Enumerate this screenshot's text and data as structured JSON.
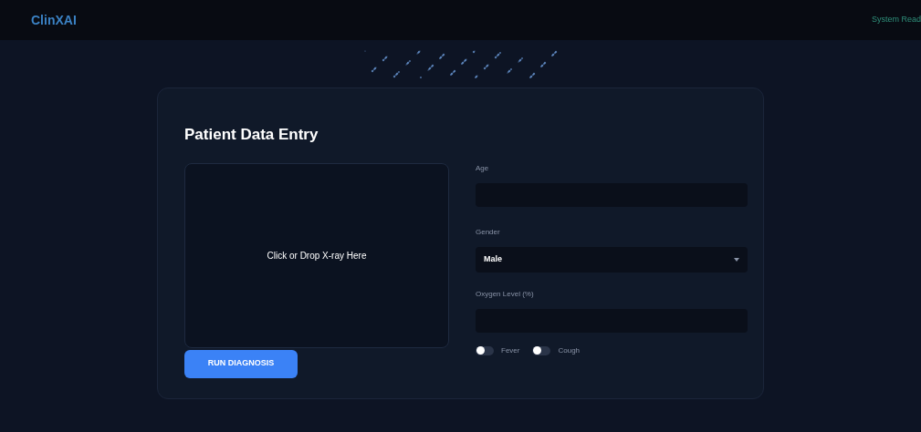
{
  "header": {
    "logo": "ClinXAI",
    "status": "System Read"
  },
  "form": {
    "title": "Patient Data Entry",
    "dropzone": "Click or Drop X-ray Here",
    "button": "RUN DIAGNOSIS",
    "fields": [
      {
        "kind": "input",
        "label": "Age"
      },
      {
        "kind": "select",
        "label": "Gender",
        "value": "Male"
      },
      {
        "kind": "input",
        "label": "Oxygen Level (%)"
      }
    ],
    "toggles": [
      {
        "label": "Fever",
        "on": false
      },
      {
        "label": "Cough",
        "on": false
      }
    ]
  }
}
